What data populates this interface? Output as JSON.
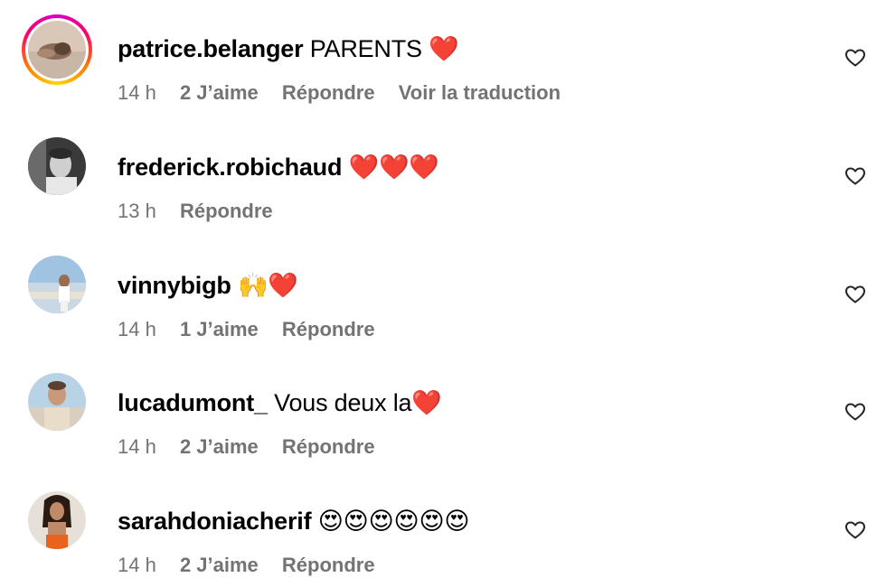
{
  "comments": [
    {
      "username": "patrice.belanger",
      "text": "PARENTS ❤️",
      "time": "14 h",
      "likes": "2 J’aime",
      "reply": "Répondre",
      "translate": "Voir la traduction",
      "has_story_ring": true
    },
    {
      "username": "frederick.robichaud",
      "text": "❤️❤️❤️",
      "time": "13 h",
      "reply": "Répondre",
      "has_story_ring": false
    },
    {
      "username": "vinnybigb",
      "text": "🙌❤️",
      "time": "14 h",
      "likes": "1 J’aime",
      "reply": "Répondre",
      "has_story_ring": false
    },
    {
      "username": "lucadumont_",
      "text": "Vous deux la❤️",
      "time": "14 h",
      "likes": "2 J’aime",
      "reply": "Répondre",
      "has_story_ring": false
    },
    {
      "username": "sarahdoniacherif",
      "text": "😍😍😍😍😍😍",
      "time": "14 h",
      "likes": "2 J’aime",
      "reply": "Répondre",
      "has_story_ring": false
    }
  ],
  "icons": {
    "like": "heart-outline-icon",
    "avatar_ring_colors": [
      "#d300c5",
      "#ff0069",
      "#ff7a00",
      "#ffd600"
    ]
  },
  "colors": {
    "text": "#000000",
    "meta": "#737373"
  }
}
